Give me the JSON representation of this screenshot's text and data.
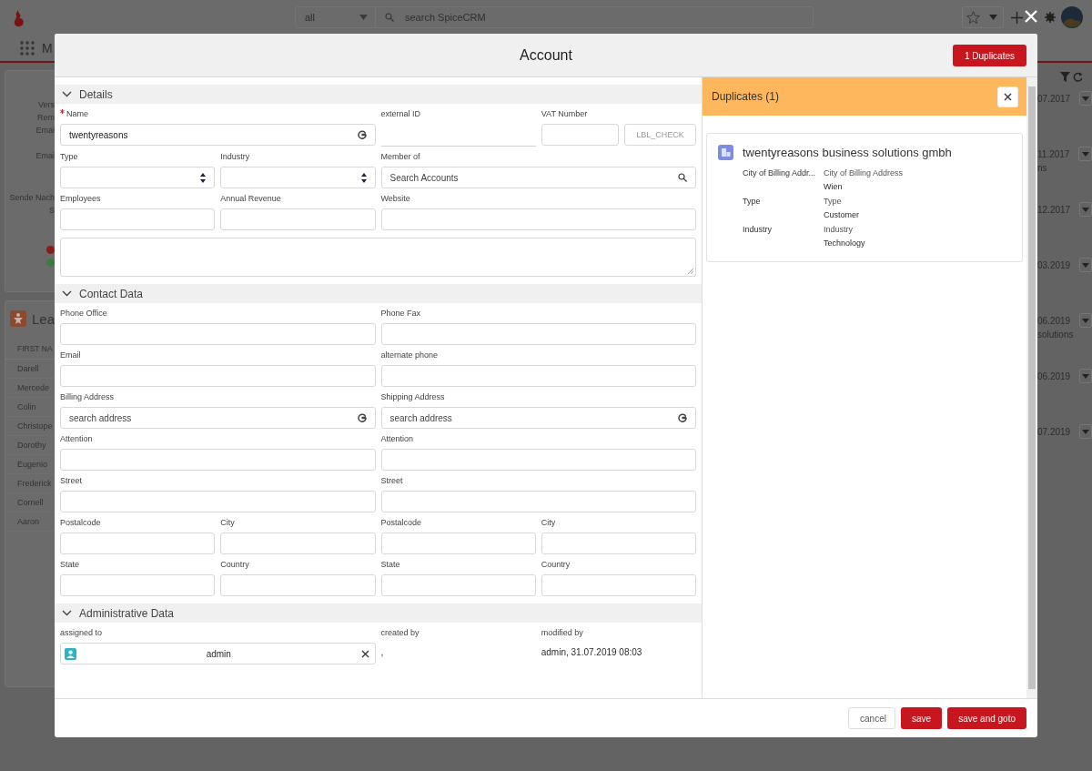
{
  "app_header": {
    "scope": "all",
    "search_placeholder": "search SpiceCRM",
    "nav_label": "M"
  },
  "background_panel": {
    "labels": [
      "Vers",
      "Rem",
      "Emai",
      "Emai",
      "Sende Nach",
      "S"
    ],
    "status_dots": [
      {
        "color": "#8a1c1c"
      },
      {
        "color": "#3d7a3d"
      }
    ]
  },
  "leads": {
    "title": "Lea",
    "column_1": "FIRST NA",
    "rows": [
      "Darell",
      "Mercede",
      "Colin",
      "Christope",
      "Dorothy",
      "Eugenio",
      "Frederick",
      "Cornell",
      "Aaron"
    ]
  },
  "right_column": [
    {
      "date": "07.2017"
    },
    {
      "date": "11.2017",
      "note": "ns"
    },
    {
      "date": "12.2017"
    },
    {
      "date": "03.2019"
    },
    {
      "date": "06.2019",
      "note": "solutions"
    },
    {
      "date": "06.2019"
    },
    {
      "date": "07.2019"
    }
  ],
  "modal": {
    "title": "Account",
    "duplicates_button": "1 Duplicates",
    "sections": [
      {
        "title": "Details",
        "expanded": true,
        "rows": [
          {
            "left": [
              {
                "kind": "google",
                "label": "Name",
                "required": true,
                "value": "twentyreasons"
              }
            ],
            "right": [
              {
                "kind": "underline",
                "label": "external ID"
              },
              {
                "kind": "vat-check",
                "label": "VAT Number",
                "button": "LBL_CHECK",
                "disabled": true
              }
            ]
          },
          {
            "left": [
              {
                "kind": "select",
                "label": "Type"
              },
              {
                "kind": "select",
                "label": "Industry"
              }
            ],
            "right": [
              {
                "kind": "lookup",
                "label": "Member of",
                "placeholder": "Search Accounts"
              }
            ]
          },
          {
            "left": [
              {
                "kind": "text",
                "label": "Employees"
              },
              {
                "kind": "text",
                "label": "Annual Revenue"
              }
            ],
            "right": [
              {
                "kind": "text",
                "label": "Website"
              }
            ]
          },
          {
            "left": [
              {
                "kind": "textarea"
              }
            ]
          }
        ]
      },
      {
        "title": "Contact Data",
        "expanded": true,
        "rows": [
          {
            "left": [
              {
                "kind": "text",
                "label": "Phone Office"
              }
            ],
            "right": [
              {
                "kind": "text",
                "label": "Phone Fax"
              }
            ]
          },
          {
            "left": [
              {
                "kind": "text",
                "label": "Email"
              }
            ],
            "right": [
              {
                "kind": "text",
                "label": "alternate phone"
              }
            ]
          },
          {
            "left": [
              {
                "kind": "google",
                "label": "Billing Address",
                "placeholder": "search address"
              }
            ],
            "right": [
              {
                "kind": "google",
                "label": "Shipping Address",
                "placeholder": "search address"
              }
            ]
          },
          {
            "left": [
              {
                "kind": "text",
                "label": "Attention"
              }
            ],
            "right": [
              {
                "kind": "text",
                "label": "Attention"
              }
            ]
          },
          {
            "left": [
              {
                "kind": "text",
                "label": "Street"
              }
            ],
            "right": [
              {
                "kind": "text",
                "label": "Street"
              }
            ]
          },
          {
            "left": [
              {
                "kind": "text",
                "label": "Postalcode"
              },
              {
                "kind": "text",
                "label": "City"
              }
            ],
            "right": [
              {
                "kind": "text",
                "label": "Postalcode"
              },
              {
                "kind": "text",
                "label": "City"
              }
            ]
          },
          {
            "left": [
              {
                "kind": "text",
                "label": "State"
              },
              {
                "kind": "text",
                "label": "Country"
              }
            ],
            "right": [
              {
                "kind": "text",
                "label": "State"
              },
              {
                "kind": "text",
                "label": "Country"
              }
            ]
          }
        ]
      },
      {
        "title": "Administrative Data",
        "expanded": true,
        "rows": [
          {
            "left": [
              {
                "kind": "user",
                "label": "assigned to",
                "value": "admin"
              }
            ],
            "right": [
              {
                "kind": "static",
                "label": "created by",
                "value": ","
              },
              {
                "kind": "static",
                "label": "modified by",
                "value": "admin, 31.07.2019 08:03"
              }
            ]
          }
        ]
      }
    ],
    "duplicates": {
      "title": "Duplicates (1)",
      "items": [
        {
          "name": "twentyreasons business solutions gmbh",
          "rows": [
            {
              "label": "City of Billing Addr...",
              "field": "City of Billing Address",
              "value": "Wien"
            },
            {
              "label": "Type",
              "field": "Type",
              "value": "Customer"
            },
            {
              "label": "Industry",
              "field": "Industry",
              "value": "Technology"
            }
          ]
        }
      ]
    },
    "footer_buttons": [
      {
        "label": "cancel",
        "kind": "neutral"
      },
      {
        "label": "save",
        "kind": "brand"
      },
      {
        "label": "save and goto",
        "kind": "brand"
      }
    ]
  }
}
